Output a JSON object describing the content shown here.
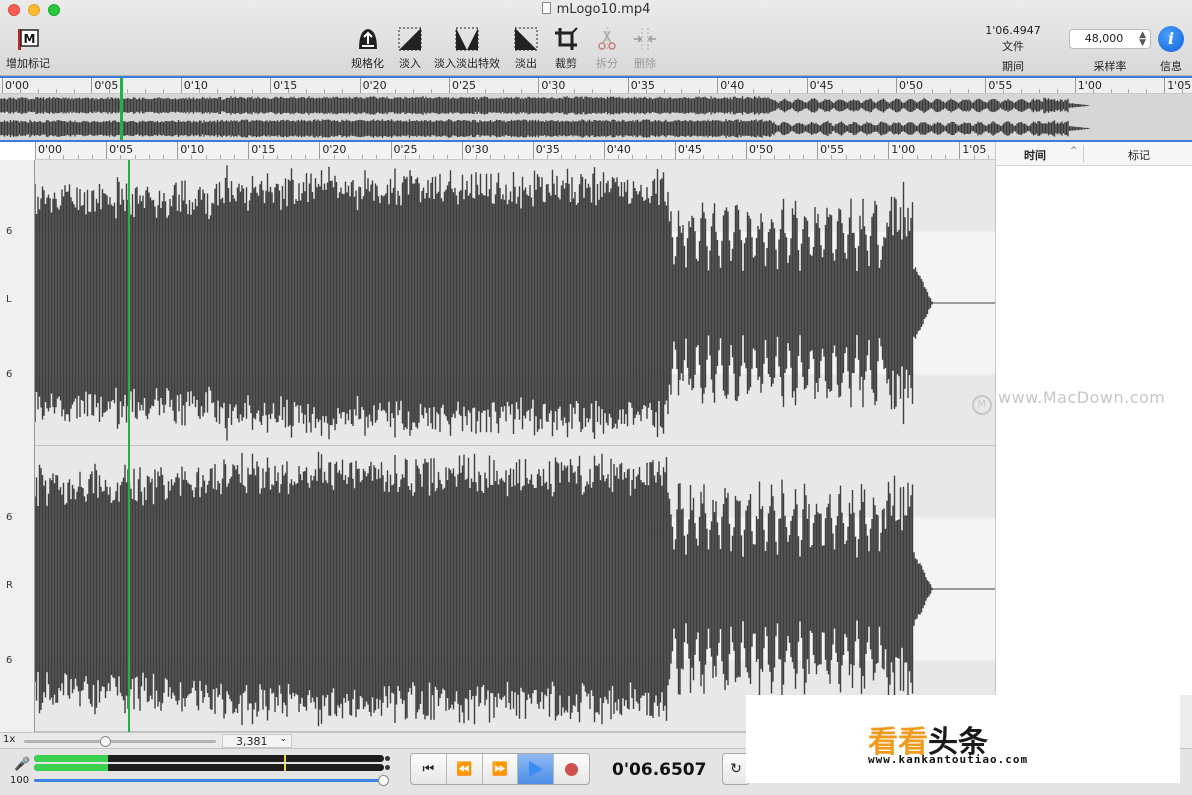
{
  "window": {
    "title": "mLogo10.mp4"
  },
  "toolbar": {
    "add_marker": "增加标记",
    "normalize": "规格化",
    "fade_in": "淡入",
    "crossfade": "淡入淡出特效",
    "fade_out": "淡出",
    "crop": "裁剪",
    "split": "拆分",
    "delete": "删除",
    "duration_value": "1'06.4947",
    "duration_source": "文件",
    "duration_label": "期间",
    "sample_rate_value": "48,000",
    "sample_rate_label": "采样率",
    "info_label": "信息"
  },
  "overview": {
    "ticks": [
      "0'00",
      "0'05",
      "0'10",
      "0'15",
      "0'20",
      "0'25",
      "0'30",
      "0'35",
      "0'40",
      "0'45",
      "0'50",
      "0'55",
      "1'00",
      "1'05"
    ]
  },
  "main": {
    "ticks": [
      "0'00",
      "0'05",
      "0'10",
      "0'15",
      "0'20",
      "0'25",
      "0'30",
      "0'35",
      "0'40",
      "0'45",
      "0'50",
      "0'55",
      "1'00",
      "1'05"
    ],
    "gutter_left": [
      "6",
      "L",
      "6"
    ],
    "gutter_right": [
      "6",
      "R",
      "6"
    ]
  },
  "markers_panel": {
    "col_time": "时间",
    "col_marker": "标记",
    "sort_arrow": "^"
  },
  "zoom": {
    "multiplier": "1x",
    "value": "3,381",
    "zoom_fraction": 0.42
  },
  "bottom": {
    "volume": "100",
    "meter_left_level": 0.21,
    "meter_right_level": 0.21,
    "time": "0'06.6507"
  },
  "watermarks": {
    "macdown": "www.MacDown.com",
    "kankan_a": "看看",
    "kankan_b": "头条",
    "kankan_url": "www.kankantoutiao.com"
  },
  "colors": {
    "playhead": "#21b340",
    "selection": "#3a7bd5",
    "waveform": "#3f3f3f"
  }
}
